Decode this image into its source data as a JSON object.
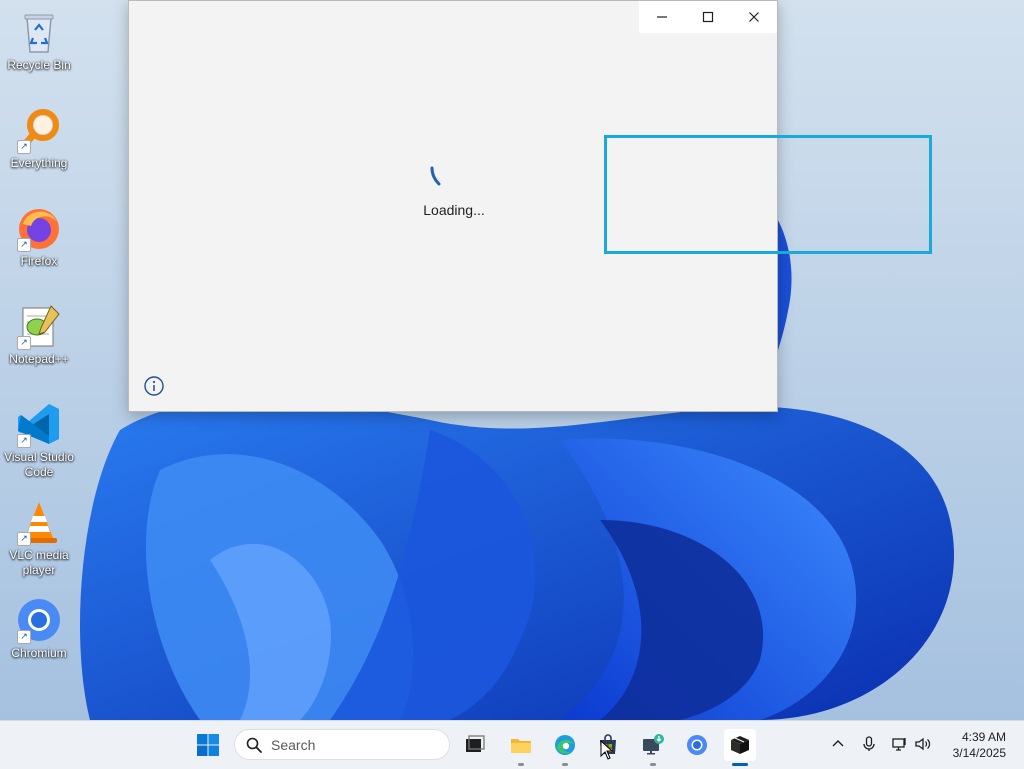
{
  "desktop": {
    "icons": [
      {
        "label": "Recycle Bin",
        "icon": "recycle-bin-icon",
        "shortcut": false
      },
      {
        "label": "Everything",
        "icon": "everything-search-icon",
        "shortcut": true
      },
      {
        "label": "Firefox",
        "icon": "firefox-icon",
        "shortcut": true
      },
      {
        "label": "Notepad++",
        "icon": "notepadpp-icon",
        "shortcut": true
      },
      {
        "label": "Visual Studio Code",
        "icon": "vscode-icon",
        "shortcut": true
      },
      {
        "label": "VLC media player",
        "icon": "vlc-icon",
        "shortcut": true
      },
      {
        "label": "Chromium",
        "icon": "chromium-icon",
        "shortcut": true
      }
    ]
  },
  "window": {
    "loading_text": "Loading...",
    "caption_buttons": [
      "minimize",
      "maximize",
      "close"
    ]
  },
  "taskbar": {
    "search_placeholder": "Search",
    "apps": [
      "start",
      "task-view",
      "file-explorer",
      "edge",
      "store",
      "app-installer",
      "chromium",
      "package"
    ],
    "clock": {
      "time": "4:39 AM",
      "date": "3/14/2025"
    }
  },
  "colors": {
    "accent": "#005fb8",
    "highlight": "#1aa9dc",
    "window_bg": "#f3f3f3",
    "taskbar_bg": "#eef2f7"
  }
}
